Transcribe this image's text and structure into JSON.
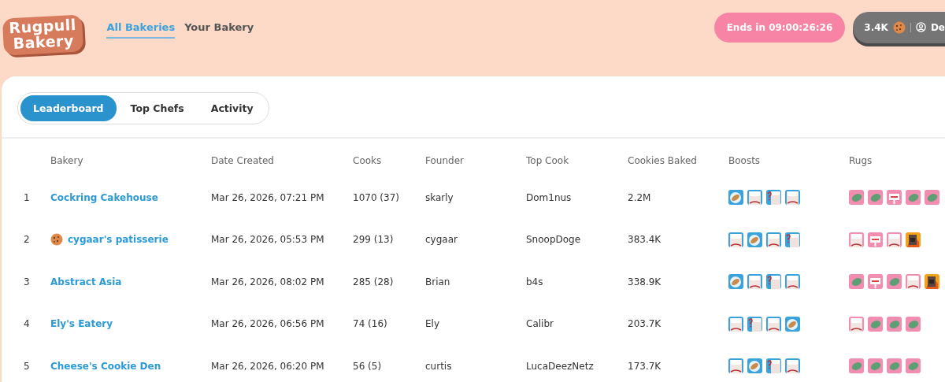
{
  "logo": {
    "lines": [
      "Rugpull",
      "Bakery"
    ]
  },
  "nav": [
    {
      "label": "All Bakeries",
      "selected": true
    },
    {
      "label": "Your Bakery",
      "selected": false
    }
  ],
  "countdown": "Ends in 09:00:26:26",
  "account": {
    "balance": "3.4K",
    "user": "De"
  },
  "tabs": [
    {
      "label": "Leaderboard",
      "selected": true
    },
    {
      "label": "Top Chefs",
      "selected": false
    },
    {
      "label": "Activity",
      "selected": false
    }
  ],
  "table": {
    "columns": [
      "Bakery",
      "Date Created",
      "Cooks",
      "Founder",
      "Top Cook",
      "Cookies Baked",
      "Boosts",
      "Rugs"
    ],
    "rows": [
      {
        "rank": "1",
        "bakery": "Cockring Cakehouse",
        "cookie_badge": false,
        "date": "Mar 26, 2026, 07:21 PM",
        "cooks": "1070 (37)",
        "founder": "skarly",
        "top_cook": "Dom1nus",
        "cookies": "2.2M",
        "boosts": [
          {
            "kind": "loaf"
          },
          {
            "kind": "chef"
          },
          {
            "kind": "chef-question"
          },
          {
            "kind": "chef"
          }
        ],
        "rugs": [
          {
            "kind": "leaf"
          },
          {
            "kind": "leaf"
          },
          {
            "kind": "stop"
          },
          {
            "kind": "leaf"
          },
          {
            "kind": "leaf"
          }
        ]
      },
      {
        "rank": "2",
        "bakery": "cygaar's patisserie",
        "cookie_badge": true,
        "date": "Mar 26, 2026, 05:53 PM",
        "cooks": "299 (13)",
        "founder": "cygaar",
        "top_cook": "SnoopDoge",
        "cookies": "383.4K",
        "boosts": [
          {
            "kind": "chef"
          },
          {
            "kind": "loaf"
          },
          {
            "kind": "chef"
          },
          {
            "kind": "chef-question"
          }
        ],
        "rugs": [
          {
            "kind": "chef"
          },
          {
            "kind": "stop"
          },
          {
            "kind": "chef"
          },
          {
            "kind": "oven"
          }
        ]
      },
      {
        "rank": "3",
        "bakery": "Abstract Asia",
        "cookie_badge": false,
        "date": "Mar 26, 2026, 08:02 PM",
        "cooks": "285 (28)",
        "founder": "Brian",
        "top_cook": "b4s",
        "cookies": "338.9K",
        "boosts": [
          {
            "kind": "loaf"
          },
          {
            "kind": "chef"
          },
          {
            "kind": "chef-question"
          },
          {
            "kind": "chef"
          }
        ],
        "rugs": [
          {
            "kind": "leaf"
          },
          {
            "kind": "stop"
          },
          {
            "kind": "leaf"
          },
          {
            "kind": "chef"
          },
          {
            "kind": "oven"
          }
        ]
      },
      {
        "rank": "4",
        "bakery": "Ely's Eatery",
        "cookie_badge": false,
        "date": "Mar 26, 2026, 06:56 PM",
        "cooks": "74 (16)",
        "founder": "Ely",
        "top_cook": "Calibr",
        "cookies": "203.7K",
        "boosts": [
          {
            "kind": "chef"
          },
          {
            "kind": "chef-question"
          },
          {
            "kind": "chef"
          },
          {
            "kind": "loaf"
          }
        ],
        "rugs": [
          {
            "kind": "chef"
          },
          {
            "kind": "leaf"
          },
          {
            "kind": "leaf"
          },
          {
            "kind": "leaf"
          }
        ]
      },
      {
        "rank": "5",
        "bakery": "Cheese's Cookie Den",
        "cookie_badge": false,
        "date": "Mar 26, 2026, 06:20 PM",
        "cooks": "56 (5)",
        "founder": "curtis",
        "top_cook": "LucaDeezNetz",
        "cookies": "173.7K",
        "boosts": [
          {
            "kind": "chef"
          },
          {
            "kind": "loaf"
          },
          {
            "kind": "chef-question"
          },
          {
            "kind": "chef"
          }
        ],
        "rugs": [
          {
            "kind": "leaf"
          },
          {
            "kind": "leaf"
          },
          {
            "kind": "leaf"
          },
          {
            "kind": "leaf"
          }
        ]
      }
    ]
  }
}
